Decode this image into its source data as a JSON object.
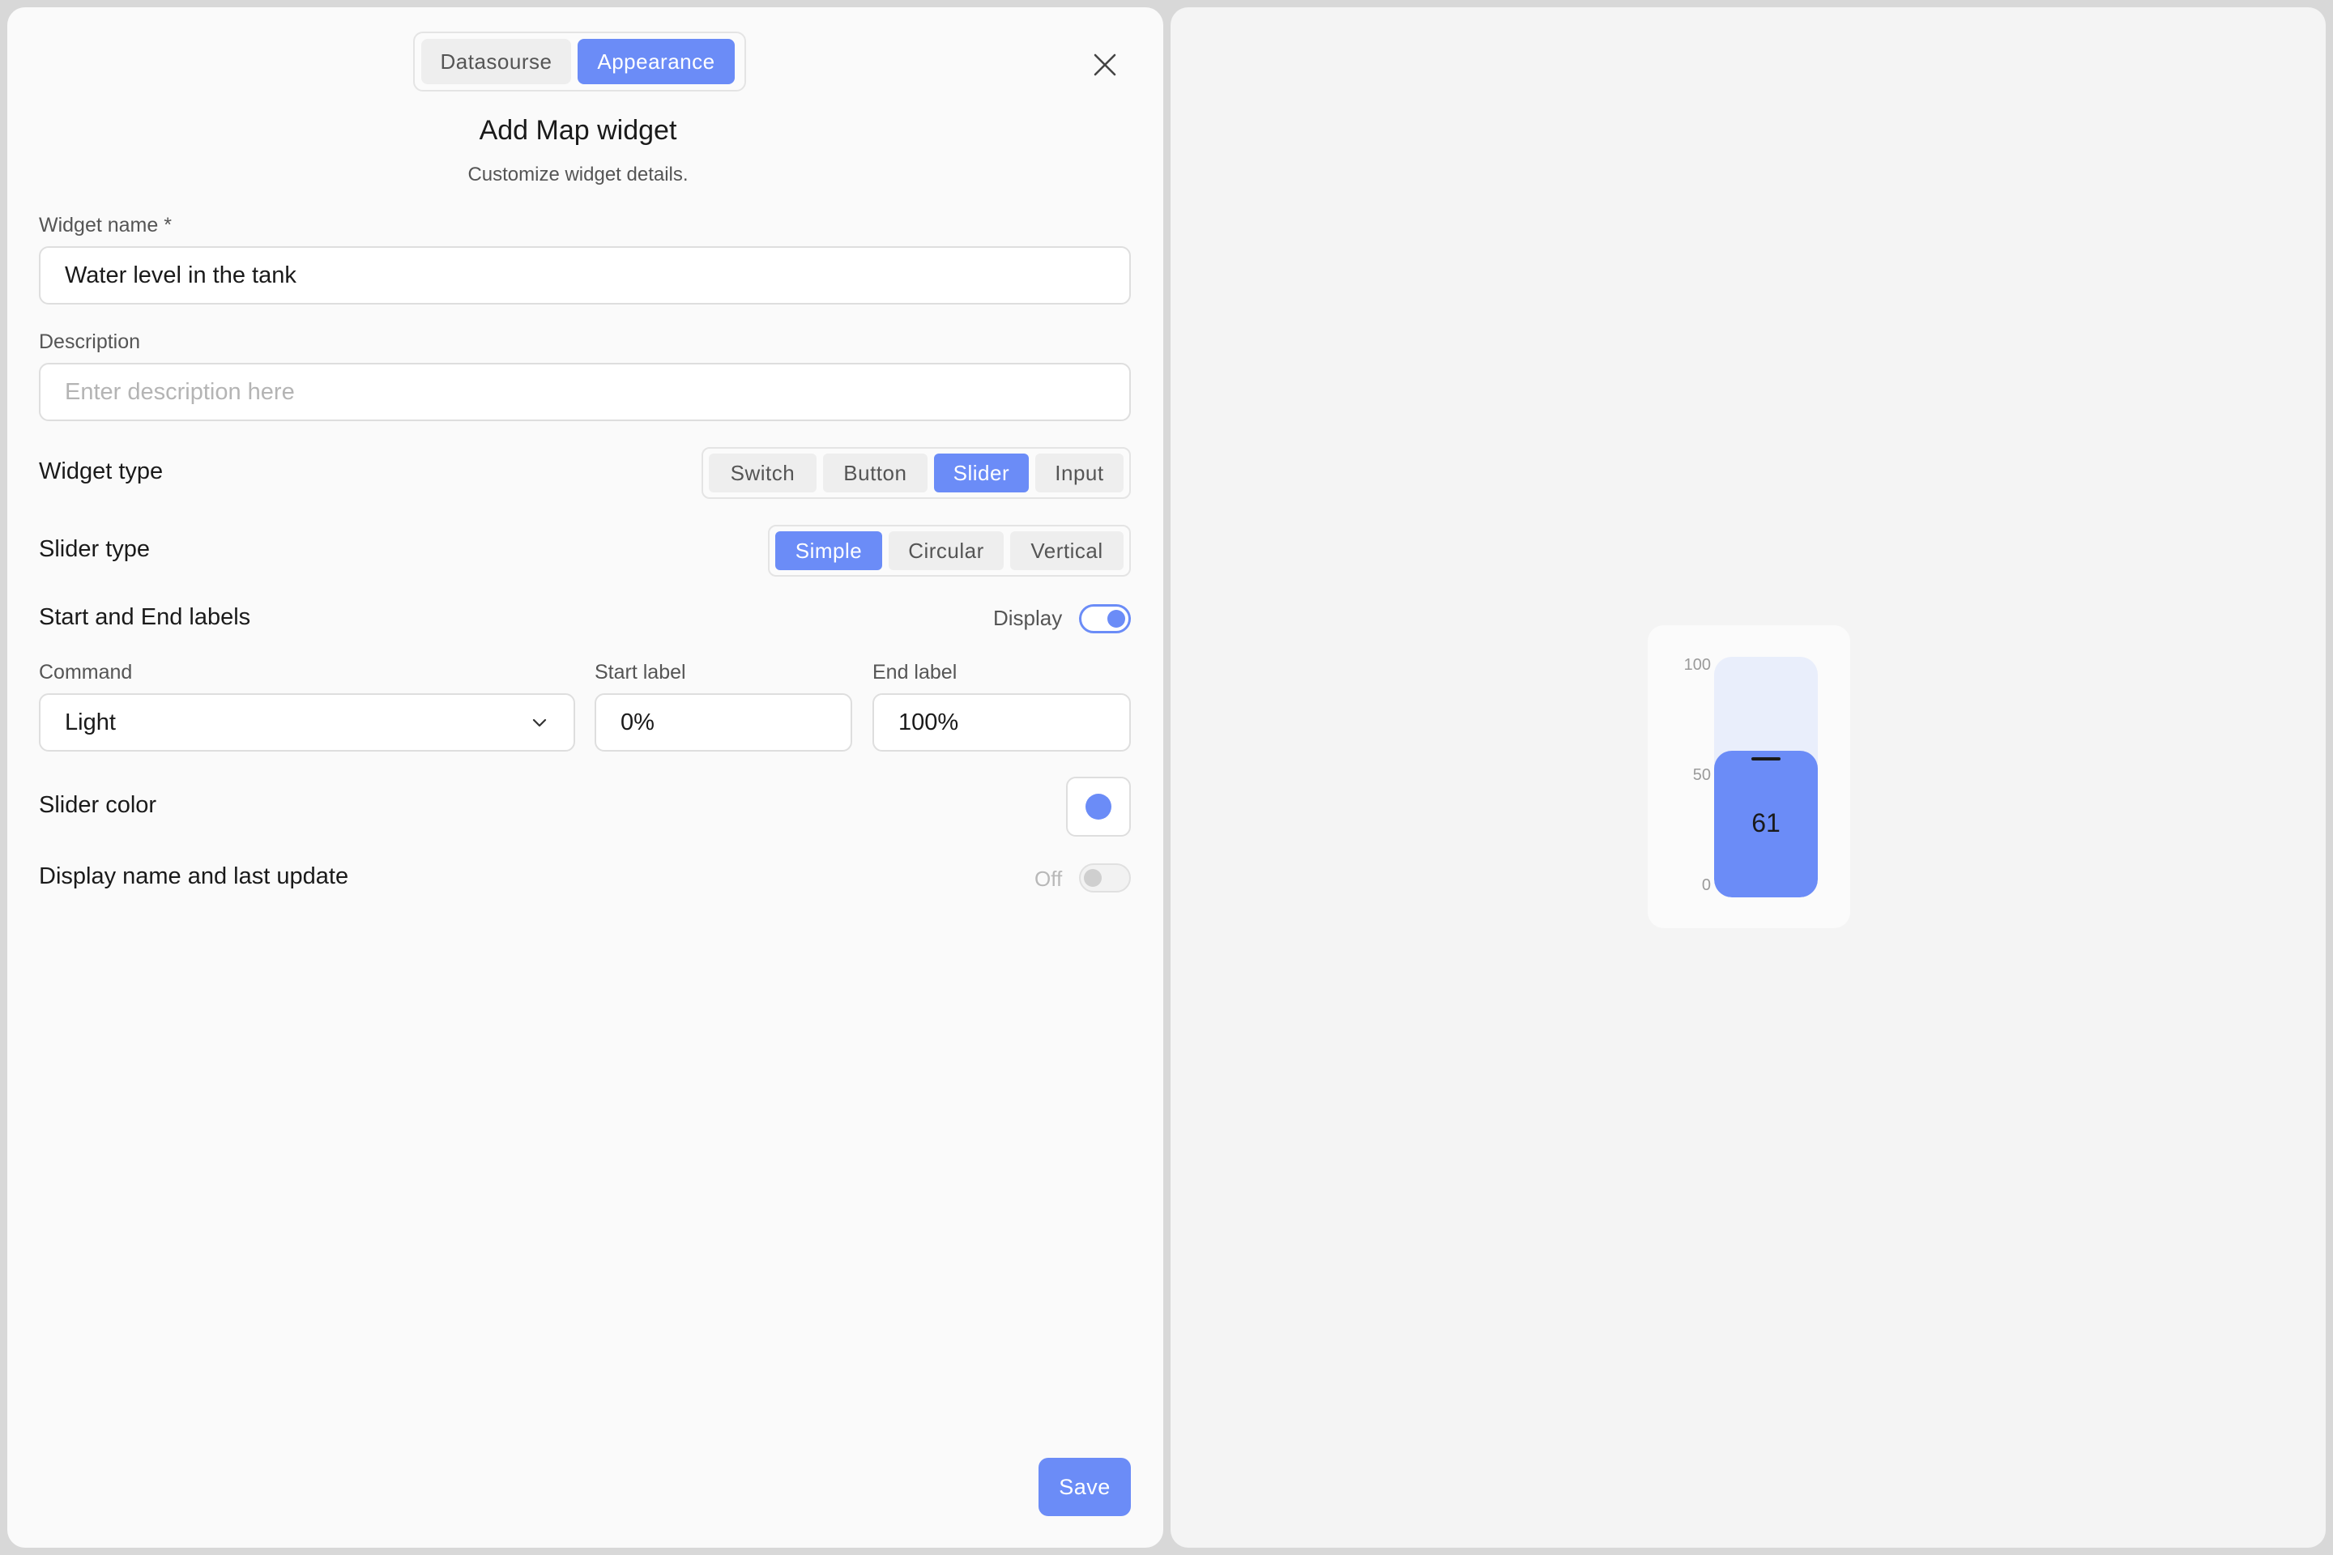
{
  "tabs": [
    {
      "label": "Datasourse",
      "active": false
    },
    {
      "label": "Appearance",
      "active": true
    }
  ],
  "header": {
    "title": "Add Map widget",
    "subtitle": "Customize widget details."
  },
  "form": {
    "widget_name": {
      "label": "Widget name *",
      "value": "Water level in the tank"
    },
    "description": {
      "label": "Description",
      "placeholder": "Enter description here"
    },
    "widget_type": {
      "label": "Widget type",
      "options": [
        "Switch",
        "Button",
        "Slider",
        "Input"
      ],
      "selected": "Slider"
    },
    "slider_type": {
      "label": "Slider type",
      "options": [
        "Simple",
        "Circular",
        "Vertical"
      ],
      "selected": "Simple"
    },
    "labels_row": {
      "label": "Start and End labels",
      "toggle_label": "Display",
      "toggle_on": true
    },
    "command": {
      "label": "Command",
      "value": "Light"
    },
    "start_label": {
      "label": "Start label",
      "value": "0%"
    },
    "end_label": {
      "label": "End label",
      "value": "100%"
    },
    "slider_color": {
      "label": "Slider color",
      "color": "#6b8cf7"
    },
    "display_name": {
      "label": "Display name and last update",
      "toggle_label": "Off",
      "toggle_on": false
    },
    "save_label": "Save"
  },
  "preview": {
    "ticks": [
      "100",
      "50",
      "0"
    ],
    "min": 0,
    "max": 100,
    "value": 61,
    "value_label": "61",
    "track_color": "#e9eefb",
    "fill_color": "#6b8cf7"
  },
  "colors": {
    "accent": "#6b8cf7"
  }
}
